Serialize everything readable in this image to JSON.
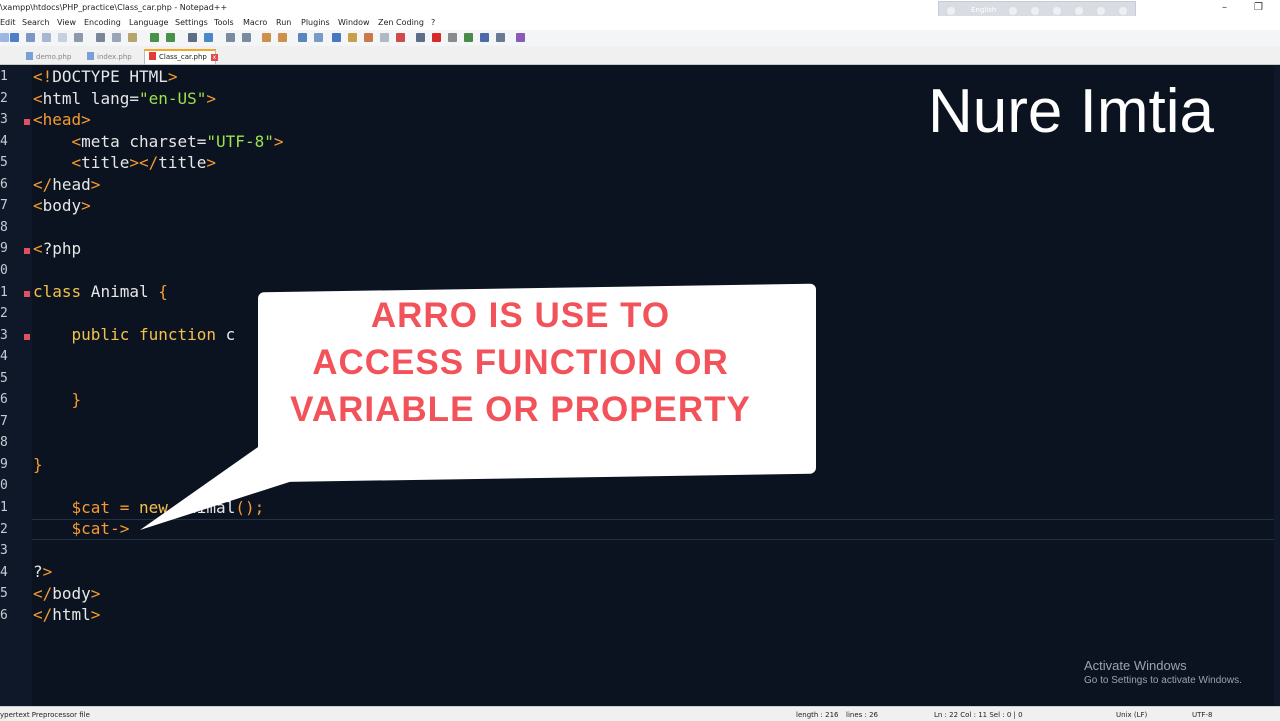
{
  "window": {
    "title": "\\xampp\\htdocs\\PHP_practice\\Class_car.php - Notepad++",
    "language_indicator": "English"
  },
  "menu": [
    "Edit",
    "Search",
    "View",
    "Encoding",
    "Language",
    "Settings",
    "Tools",
    "Macro",
    "Run",
    "Plugins",
    "Window",
    "Zen Coding",
    "?"
  ],
  "tabs": [
    {
      "label": "demo.php"
    },
    {
      "label": "index.php"
    },
    {
      "label": "Class_car.php",
      "active": true
    }
  ],
  "editor": {
    "line_numbers": [
      "1",
      "2",
      "3",
      "4",
      "5",
      "6",
      "7",
      "8",
      "9",
      "0",
      "1",
      "2",
      "3",
      "4",
      "5",
      "6",
      "7",
      "8",
      "9",
      "0",
      "1",
      "2",
      "3",
      "4",
      "5",
      "6"
    ],
    "current_line_index": 21
  },
  "watermark": "Nure Imtia",
  "callout": {
    "line1": "ARRO IS USE TO",
    "line2": "ACCESS FUNCTION OR",
    "line3": "VARIABLE OR PROPERTY"
  },
  "activation": {
    "title": "Activate Windows",
    "subtitle": "Go to Settings to activate Windows."
  },
  "status": {
    "file_type": "ypertext Preprocessor file",
    "length": "length : 216",
    "lines": "lines : 26",
    "position": "Ln : 22    Col : 11    Sel : 0 | 0",
    "eol": "Unix (LF)",
    "encoding": "UTF-8"
  },
  "colors": {
    "tag": "#f79a32",
    "string": "#9fe04c",
    "keyword": "#f3c04a",
    "callout_text": "#f2525a",
    "editor_bg": "#0b1320"
  }
}
